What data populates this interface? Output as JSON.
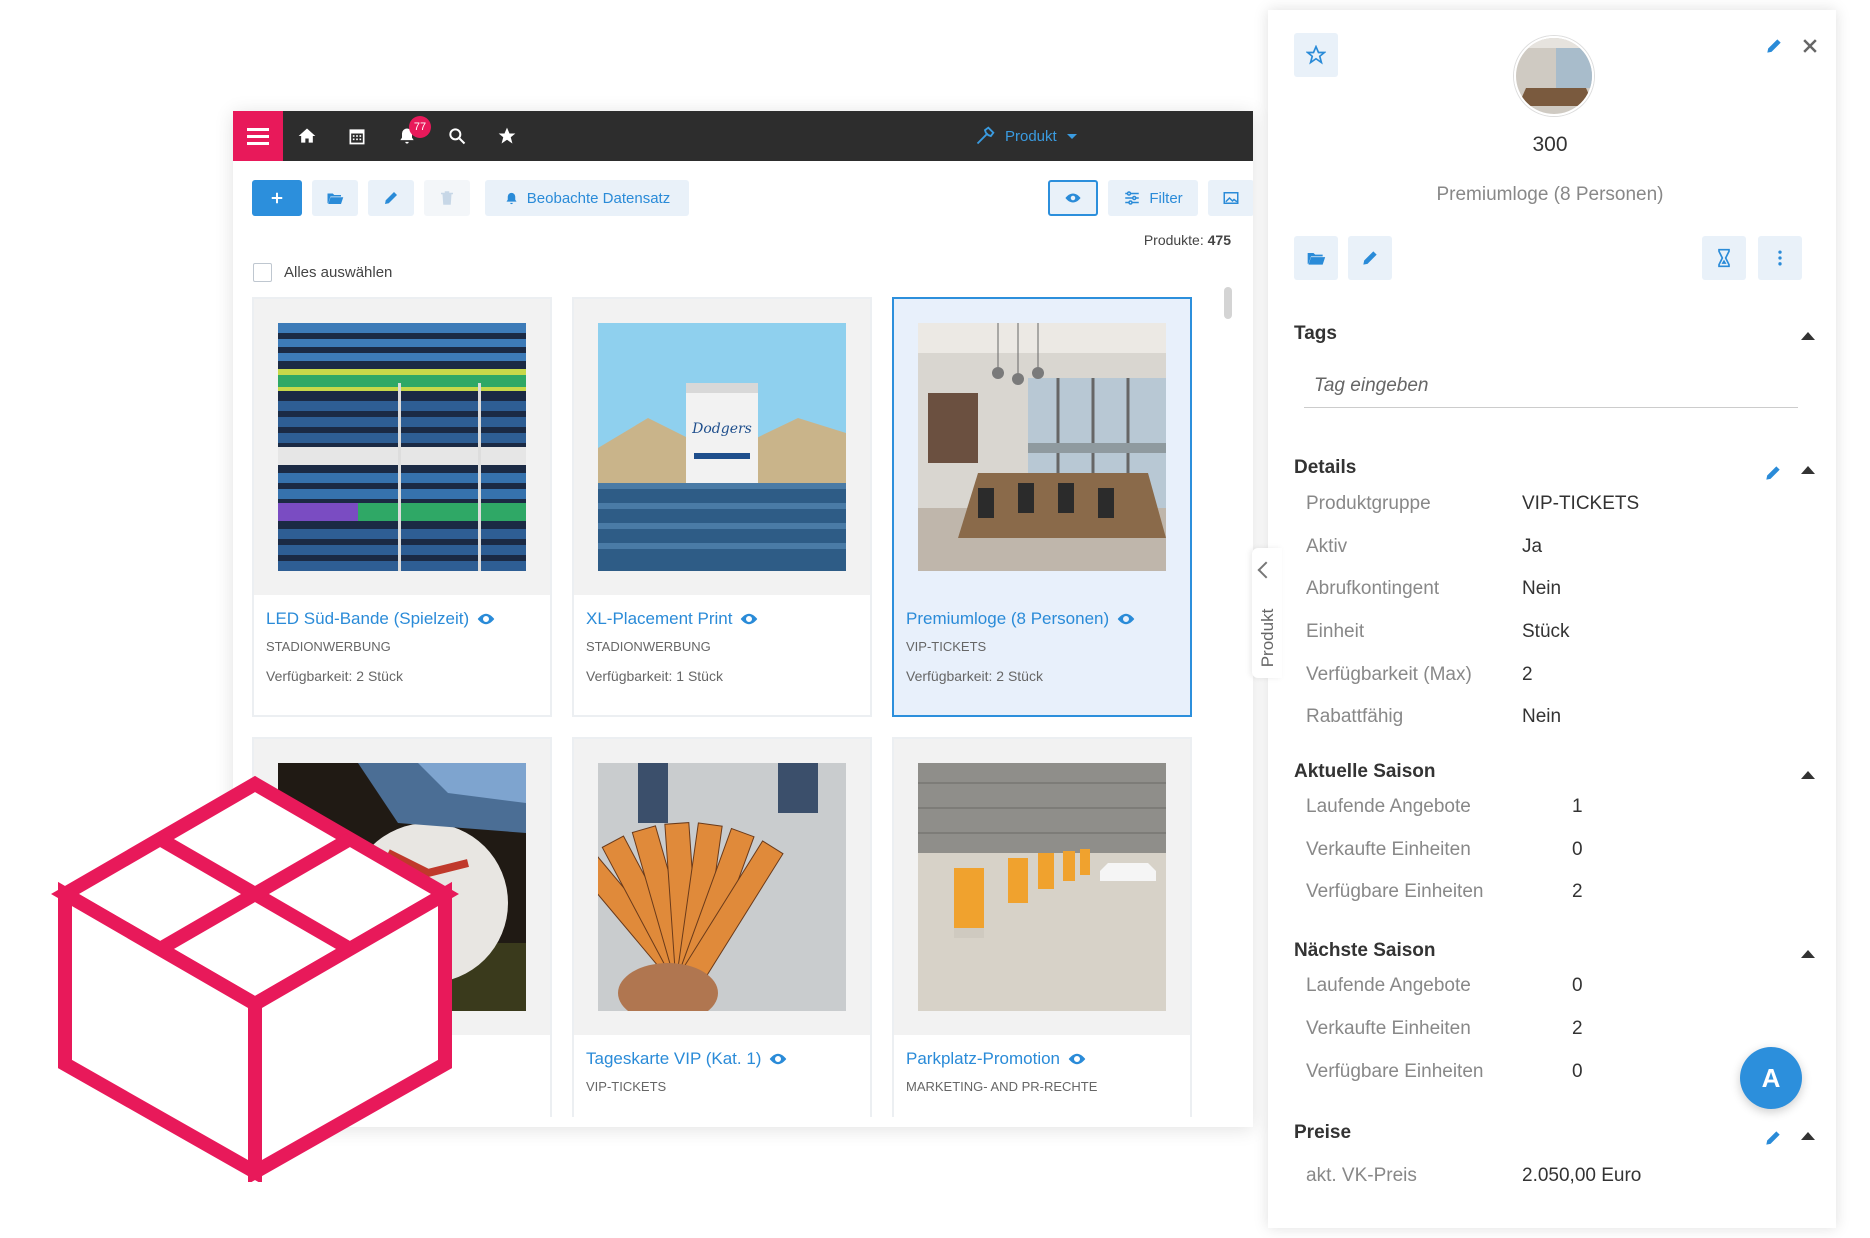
{
  "topbar": {
    "notification_count": "77",
    "module_label": "Produkt",
    "accent_color": "#e8195a"
  },
  "toolbar": {
    "watch_label": "Beobachte Datensatz",
    "filter_label": "Filter"
  },
  "list": {
    "count_label": "Produkte:",
    "count_value": "475",
    "select_all_label": "Alles auswählen"
  },
  "cards": [
    {
      "title": "LED Süd-Bande (Spielzeit)",
      "category": "STADIONWERBUNG",
      "availability": "Verfügbarkeit: 2 Stück",
      "image": "stadium-seats"
    },
    {
      "title": "XL-Placement Print",
      "category": "STADIONWERBUNG",
      "availability": "Verfügbarkeit: 1 Stück",
      "image": "stadium-tower"
    },
    {
      "title": "Premiumloge (8 Personen)",
      "category": "VIP-TICKETS",
      "availability": "Verfügbarkeit: 2 Stück",
      "image": "conference-room"
    },
    {
      "title": "",
      "category": "",
      "availability": "",
      "image": "football-boots"
    },
    {
      "title": "Tageskarte VIP (Kat. 1)",
      "category": "VIP-TICKETS",
      "availability": "",
      "image": "ticket-fan"
    },
    {
      "title": "Parkplatz-Promotion",
      "category": "MARKETING- AND PR-RECHTE",
      "availability": "",
      "image": "parking-lot"
    }
  ],
  "side_panel": {
    "tab_label": "Produkt",
    "record_id": "300",
    "record_name": "Premiumloge (8 Personen)",
    "tags_title": "Tags",
    "tag_placeholder": "Tag eingeben",
    "details_title": "Details",
    "details": [
      {
        "key": "Produktgruppe",
        "value": "VIP-TICKETS"
      },
      {
        "key": "Aktiv",
        "value": "Ja"
      },
      {
        "key": "Abrufkontingent",
        "value": "Nein"
      },
      {
        "key": "Einheit",
        "value": "Stück"
      },
      {
        "key": "Verfügbarkeit (Max)",
        "value": "2"
      },
      {
        "key": "Rabattfähig",
        "value": "Nein"
      }
    ],
    "current_season_title": "Aktuelle Saison",
    "current_season": [
      {
        "key": "Laufende Angebote",
        "value": "1"
      },
      {
        "key": "Verkaufte Einheiten",
        "value": "0"
      },
      {
        "key": "Verfügbare Einheiten",
        "value": "2"
      }
    ],
    "next_season_title": "Nächste Saison",
    "next_season": [
      {
        "key": "Laufende Angebote",
        "value": "0"
      },
      {
        "key": "Verkaufte Einheiten",
        "value": "2"
      },
      {
        "key": "Verfügbare Einheiten",
        "value": "0"
      }
    ],
    "prices_title": "Preise",
    "prices": [
      {
        "key": "akt. VK-Preis",
        "value": "2.050,00 Euro"
      }
    ],
    "fab_label": "A"
  }
}
